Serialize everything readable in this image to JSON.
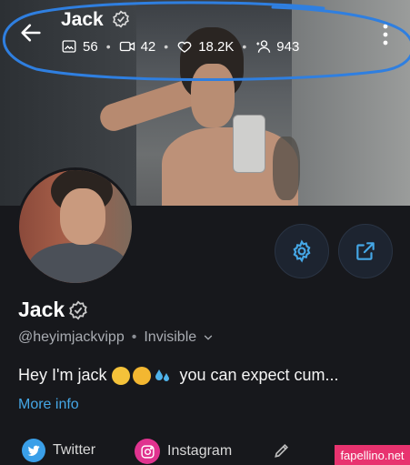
{
  "header": {
    "title": "Jack",
    "stats": {
      "photos": "56",
      "videos": "42",
      "likes": "18.2K",
      "fans": "943"
    }
  },
  "profile": {
    "name": "Jack",
    "handle": "@heyimjackvipp",
    "status": "Invisible",
    "bio_start": "Hey I'm jack",
    "bio_end": "you can expect cum...",
    "more_info": "More info"
  },
  "social": {
    "twitter": "Twitter",
    "instagram": "Instagram"
  },
  "watermark": "fapellino.net",
  "colors": {
    "accent": "#45a7e6",
    "annotation": "#2f7fe0"
  }
}
